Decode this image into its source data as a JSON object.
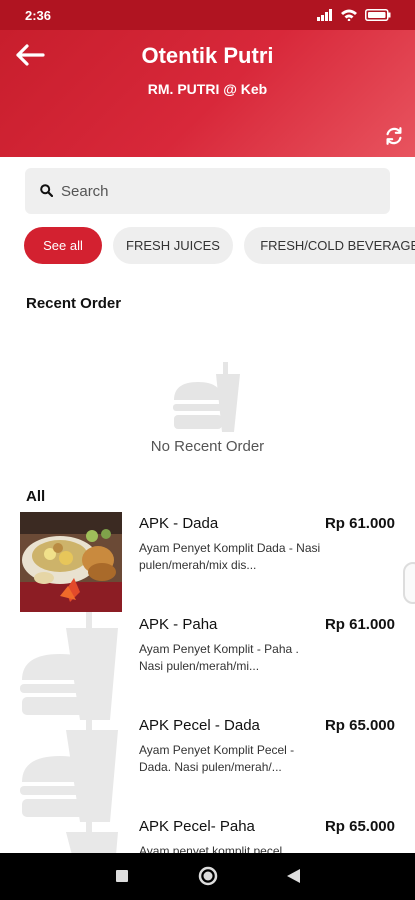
{
  "status_bar": {
    "time": "2:36"
  },
  "header": {
    "title": "Otentik Putri",
    "subtitle": "RM. PUTRI @ Keb",
    "accent_color": "#d32130",
    "back_icon": "arrow-left-icon",
    "refresh_icon": "refresh-icon"
  },
  "search": {
    "placeholder": "Search",
    "value": ""
  },
  "categories": [
    {
      "label": "See all",
      "active": true
    },
    {
      "label": "FRESH JUICES",
      "active": false
    },
    {
      "label": "FRESH/COLD BEVERAGES",
      "active": false
    }
  ],
  "recent": {
    "title": "Recent Order",
    "empty_text": "No Recent Order"
  },
  "all": {
    "title": "All",
    "items": [
      {
        "name": "APK - Dada",
        "price": "Rp 61.000",
        "desc": "Ayam Penyet Komplit Dada - Nasi pulen/merah/mix dis..."
      },
      {
        "name": "APK - Paha",
        "price": "Rp 61.000",
        "desc": "Ayam Penyet Komplit - Paha . Nasi pulen/merah/mi..."
      },
      {
        "name": "APK Pecel - Dada",
        "price": "Rp 65.000",
        "desc": "Ayam Penyet Komplit  Pecel - Dada. Nasi pulen/merah/..."
      },
      {
        "name": "APK Pecel- Paha",
        "price": "Rp 65.000",
        "desc": "Ayam penyet komplit pecel"
      }
    ]
  }
}
